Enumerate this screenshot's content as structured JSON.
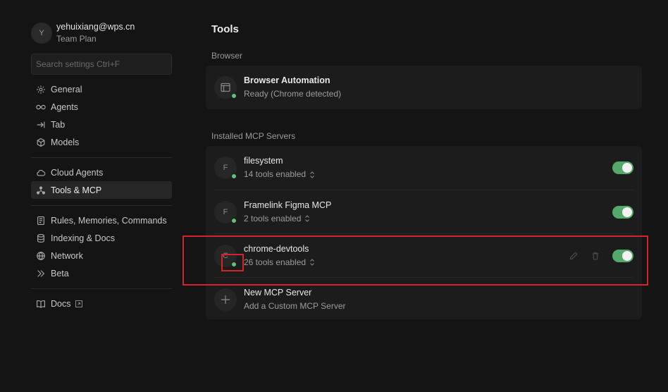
{
  "profile": {
    "avatar_initial": "Y",
    "email": "yehuixiang@wps.cn",
    "plan": "Team Plan"
  },
  "search": {
    "placeholder": "Search settings Ctrl+F"
  },
  "sidebar": {
    "groups": [
      [
        {
          "label": "General",
          "icon": "gear-icon"
        },
        {
          "label": "Agents",
          "icon": "infinity-icon"
        },
        {
          "label": "Tab",
          "icon": "tab-arrow-icon"
        },
        {
          "label": "Models",
          "icon": "cube-icon"
        }
      ],
      [
        {
          "label": "Cloud Agents",
          "icon": "cloud-icon"
        },
        {
          "label": "Tools & MCP",
          "icon": "nodes-icon",
          "active": true
        }
      ],
      [
        {
          "label": "Rules, Memories, Commands",
          "icon": "document-icon"
        },
        {
          "label": "Indexing & Docs",
          "icon": "database-icon"
        },
        {
          "label": "Network",
          "icon": "globe-icon"
        },
        {
          "label": "Beta",
          "icon": "double-chevron-icon"
        }
      ],
      [
        {
          "label": "Docs",
          "icon": "book-icon",
          "external": true
        }
      ]
    ]
  },
  "main": {
    "title": "Tools",
    "browser_section": {
      "label": "Browser",
      "item": {
        "title": "Browser Automation",
        "subtitle": "Ready (Chrome detected)",
        "icon": "browser-window-icon",
        "status": "ready"
      }
    },
    "mcp_section": {
      "label": "Installed MCP Servers",
      "servers": [
        {
          "initial": "F",
          "name": "filesystem",
          "tools": "14 tools enabled",
          "enabled": true
        },
        {
          "initial": "F",
          "name": "Framelink Figma MCP",
          "tools": "2 tools enabled",
          "enabled": true
        },
        {
          "initial": "C",
          "name": "chrome-devtools",
          "tools": "26 tools enabled",
          "enabled": true
        }
      ],
      "new_server": {
        "title": "New MCP Server",
        "subtitle": "Add a Custom MCP Server"
      }
    }
  },
  "colors": {
    "background": "#141414",
    "card": "#1c1c1c",
    "status_green": "#5fc27a",
    "toggle_on": "#55a86c",
    "highlight": "#d5232c"
  }
}
